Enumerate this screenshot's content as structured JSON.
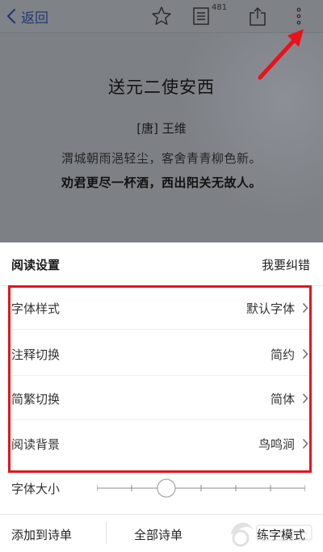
{
  "navbar": {
    "back_label": "返回",
    "back_icon": "chevron-left-icon",
    "favorite_icon": "star-outline-icon",
    "list_icon": "document-list-icon",
    "list_count": "481",
    "share_icon": "share-upload-icon",
    "more_icon": "vertical-ellipsis-icon",
    "link_color": "#1f3a78"
  },
  "poem": {
    "title": "送元二使安西",
    "author": "[唐] 王维",
    "lines": [
      "渭城朝雨浥轻尘，客舍青青柳色新。",
      "劝君更尽一杯酒，西出阳关无故人。"
    ]
  },
  "sheet": {
    "title": "阅读设置",
    "report_link": "我要纠错",
    "settings": [
      {
        "label": "字体样式",
        "value": "默认字体"
      },
      {
        "label": "注释切换",
        "value": "简约"
      },
      {
        "label": "简繁切换",
        "value": "简体"
      },
      {
        "label": "阅读背景",
        "value": "鸟鸣涧"
      }
    ],
    "font_size": {
      "label": "字体大小",
      "tick_count": 7,
      "selected_tick_index": 2
    },
    "bottom_buttons": [
      "添加到诗单",
      "全部诗单",
      "练字模式"
    ]
  },
  "colors": {
    "dim_overlay": "#7d8085",
    "annotation_red": "#e8121b",
    "divider": "#ededed"
  }
}
